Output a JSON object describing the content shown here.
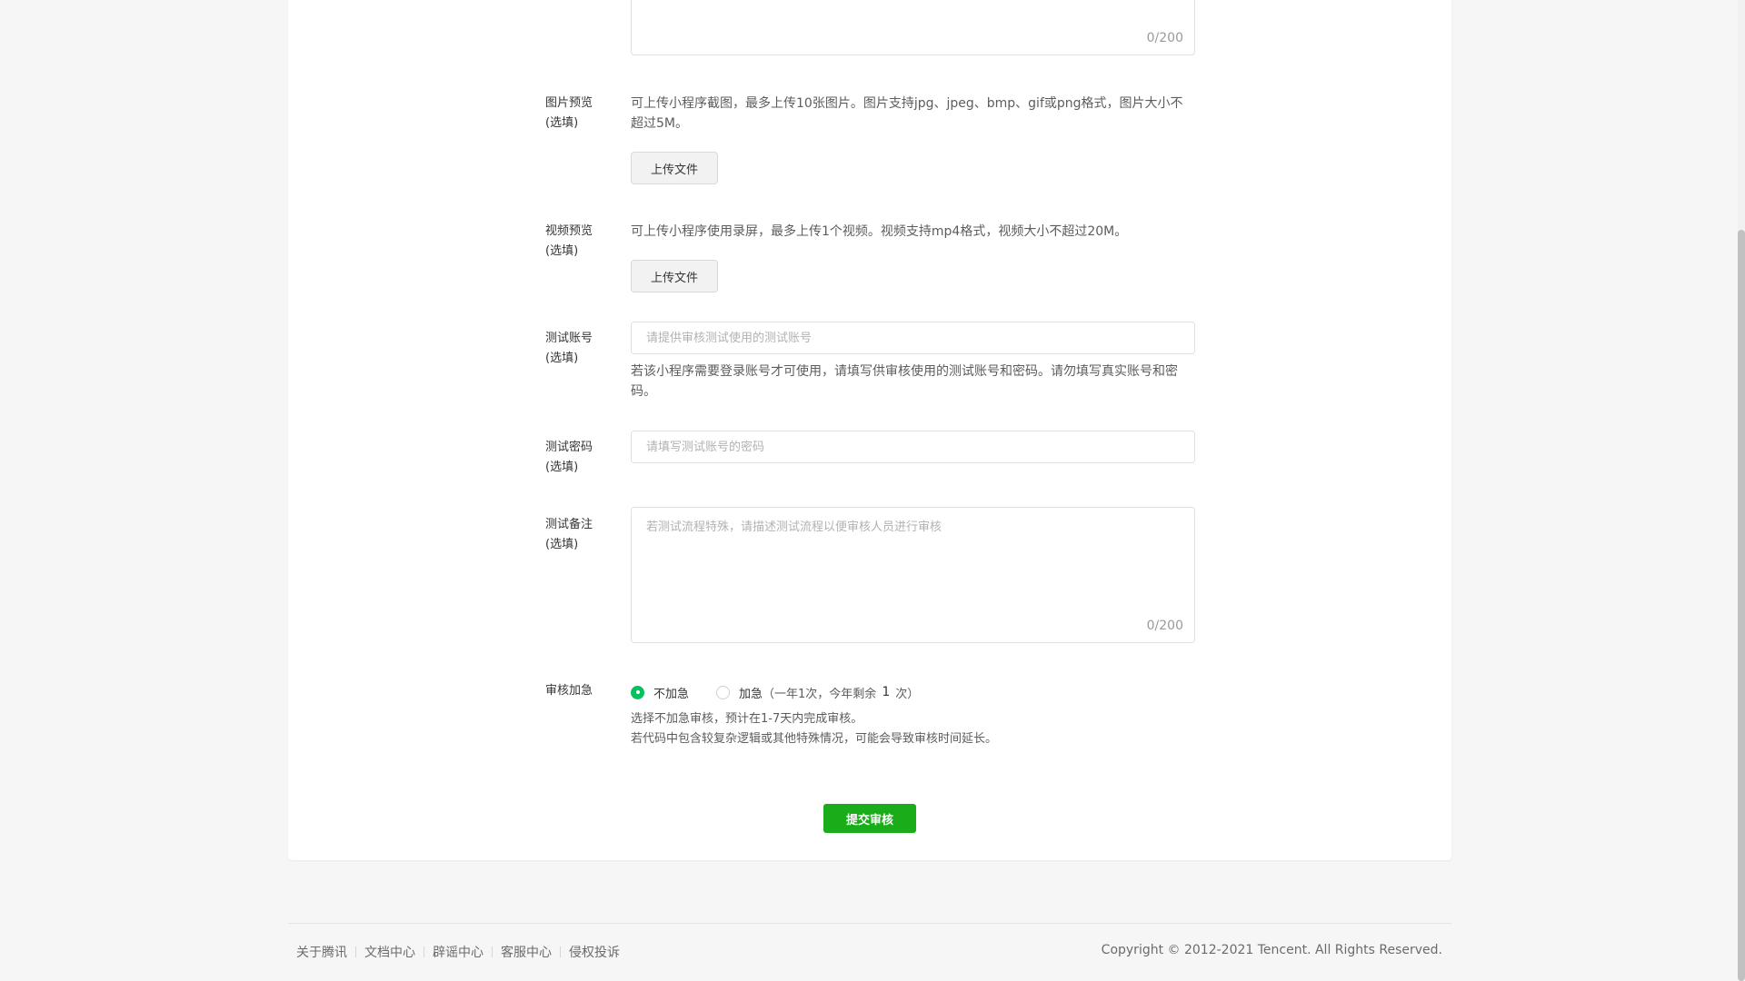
{
  "top_textarea": {
    "counter": "0/200"
  },
  "image_preview": {
    "label_line1": "图片预览",
    "label_line2": "(选填)",
    "desc": "可上传小程序截图，最多上传10张图片。图片支持jpg、jpeg、bmp、gif或png格式，图片大小不超过5M。",
    "button": "上传文件"
  },
  "video_preview": {
    "label_line1": "视频预览",
    "label_line2": "(选填)",
    "desc": "可上传小程序使用录屏，最多上传1个视频。视频支持mp4格式，视频大小不超过20M。",
    "button": "上传文件"
  },
  "test_account": {
    "label_line1": "测试账号",
    "label_line2": "(选填)",
    "placeholder": "请提供审核测试使用的测试账号",
    "desc": "若该小程序需要登录账号才可使用，请填写供审核使用的测试账号和密码。请勿填写真实账号和密码。"
  },
  "test_password": {
    "label_line1": "测试密码",
    "label_line2": "(选填)",
    "placeholder": "请填写测试账号的密码"
  },
  "test_notes": {
    "label_line1": "测试备注",
    "label_line2": "(选填)",
    "placeholder": "若测试流程特殊，请描述测试流程以便审核人员进行审核",
    "counter": "0/200"
  },
  "review_urgent": {
    "label": "审核加急",
    "option_normal": "不加急",
    "option_urgent": "加急",
    "urgent_note_prefix": "（一年1次，今年剩余",
    "urgent_remaining": "1",
    "urgent_note_suffix": "次）",
    "selected": "不加急",
    "desc_line1": "选择不加急审核，预计在1-7天内完成审核。",
    "desc_line2": "若代码中包含较复杂逻辑或其他特殊情况，可能会导致审核时间延长。"
  },
  "submit_label": "提交审核",
  "footer": {
    "links": [
      "关于腾讯",
      "文档中心",
      "辟谣中心",
      "客服中心",
      "侵权投诉"
    ],
    "copyright": "Copyright © 2012-2021 Tencent. All Rights Reserved."
  },
  "colors": {
    "accent": "#1aad19",
    "radio_selected": "#07c160"
  }
}
